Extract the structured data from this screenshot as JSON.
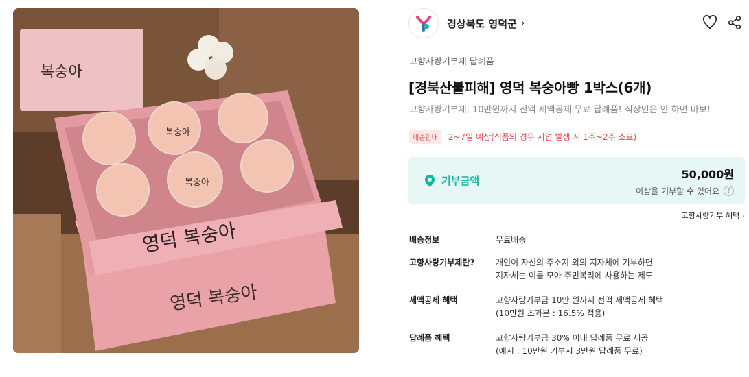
{
  "seller": {
    "name": "경상북도 영덕군",
    "arrow": "›"
  },
  "header_icons": [
    "heart-icon",
    "share-icon"
  ],
  "category": "고향사랑기부제 답례품",
  "title": "[경북산불피해] 영덕 복숭아빵 1박스(6개)",
  "subtitle": "고향사랑기부제, 10만원까지 전액 세액공제 무료 답례품! 직장인은 안 하면 바보!",
  "shipping": {
    "badge": "배송안내",
    "text": "2~7일 예상(식품의 경우 지연 발생 시 1주~2주 소요)"
  },
  "donation": {
    "label": "기부금액",
    "amount": "50,000원",
    "note": "이상을 기부할 수 있어요",
    "help": "?"
  },
  "benefit_link": "고향사랑기부 혜택 ›",
  "info_rows": [
    {
      "key": "배송정보",
      "lines": [
        "무료배송"
      ]
    },
    {
      "key": "고향사랑기부제란?",
      "lines": [
        "개인이 자신의 주소지 외의 지자체에 기부하면",
        "지자체는 이를 모아 주민복리에 사용하는 제도"
      ]
    },
    {
      "key": "세액공제 혜택",
      "lines": [
        "고향사랑기부금 10만 원까지 전액 세액공제 혜택",
        "(10만원 초과분 : 16.5% 적용)"
      ]
    },
    {
      "key": "답례품 혜택",
      "lines": [
        "고향사랑기부금 30% 이내 답례품 무료 제공",
        "(예시 : 10만원 기부시 3만원 답례품 무료)"
      ]
    }
  ],
  "photo": {
    "box_text": "영덕 복숭아",
    "box_text_back": "복숭아",
    "bread_text": "복숭아",
    "colors": {
      "box_pink": "#e9a3a8",
      "peach": "#f4c4b2",
      "wood": "#6b4a34"
    }
  },
  "colors": {
    "accent_teal": "#17b59c",
    "alert_red": "#e5484d",
    "donate_bg": "#e7f7f5"
  }
}
